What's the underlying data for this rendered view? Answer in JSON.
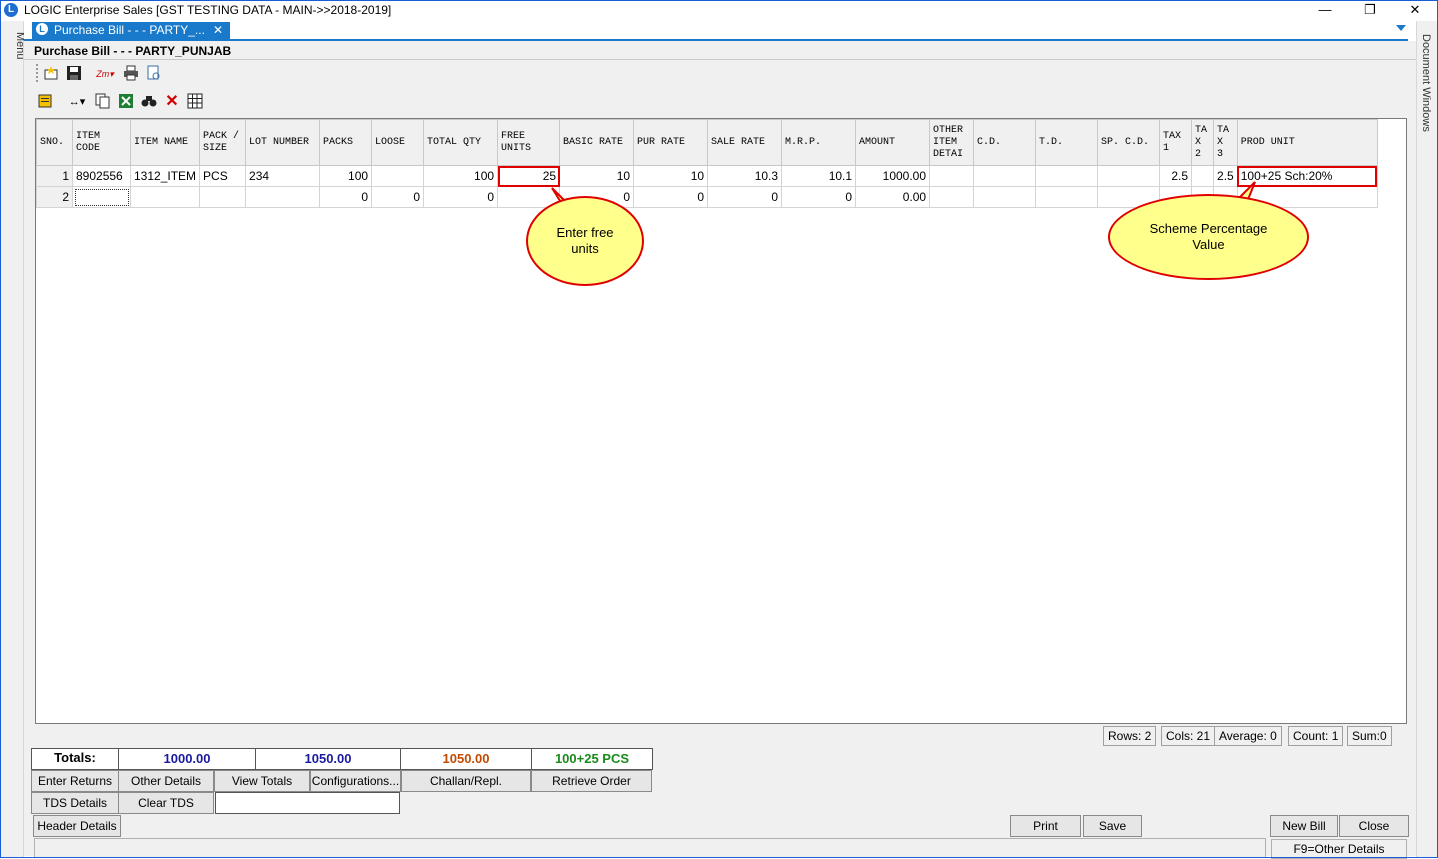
{
  "window": {
    "title": "LOGIC Enterprise Sales  [GST TESTING DATA - MAIN->>2018-2019]",
    "minimize": "—",
    "restore": "❐",
    "close": "✕"
  },
  "side": {
    "left_label": "Menu",
    "right_label": "Document Windows"
  },
  "tab": {
    "label": "Purchase Bill -  -  - PARTY_...",
    "close": "✕"
  },
  "document": {
    "title": "Purchase Bill -  -  - PARTY_PUNJAB"
  },
  "grid": {
    "columns": [
      "SNO.",
      "ITEM CODE",
      "ITEM NAME",
      "PACK / SIZE",
      "LOT NUMBER",
      "PACKS",
      "LOOSE",
      "TOTAL QTY",
      "FREE UNITS",
      "BASIC RATE",
      "PUR RATE",
      "SALE RATE",
      "M.R.P.",
      "AMOUNT",
      "OTHER ITEM DETAI",
      "C.D.",
      "T.D.",
      "SP. C.D.",
      "TAX 1",
      "TA X 2",
      "TA X 3",
      "PROD UNIT"
    ],
    "rows": [
      [
        "1",
        "8902556",
        "1312_ITEM",
        "PCS",
        "234",
        "100",
        "",
        "100",
        "25",
        "10",
        "10",
        "10.3",
        "10.1",
        "1000.00",
        "",
        "",
        "",
        "",
        "2.5",
        "",
        "2.5",
        "100+25 Sch:20%"
      ],
      [
        "2",
        "",
        "",
        "",
        "",
        "0",
        "0",
        "0",
        "",
        "0",
        "0",
        "0",
        "0",
        "0.00",
        "",
        "",
        "",
        "",
        "",
        "",
        "",
        ""
      ]
    ]
  },
  "callouts": {
    "free_units": "Enter free units",
    "scheme": "Scheme Percentage Value"
  },
  "status": {
    "rows": "Rows: 2",
    "cols": "Cols: 21",
    "average": "Average: 0",
    "count": "Count: 1",
    "sum": "Sum:0"
  },
  "totals": {
    "label": "Totals:",
    "amount": "1000.00",
    "amount2": "1050.00",
    "amount3": "1050.00",
    "units": "100+25 PCS",
    "colors": {
      "amount": "#1a1aa0",
      "amount2": "#1a1aa0",
      "amount3": "#c24a00",
      "units": "#1a8a1a"
    }
  },
  "buttons": {
    "enter_returns": "Enter Returns",
    "other_details": "Other Details",
    "view_totals": "View Totals",
    "configurations": "Configurations...",
    "challan": "Challan/Repl.",
    "retrieve_order": "Retrieve Order",
    "tds_details": "TDS Details",
    "clear_tds": "Clear TDS",
    "header_details": "Header Details",
    "print": "Print",
    "save": "Save",
    "new_bill": "New Bill",
    "close": "Close",
    "f9_other": "F9=Other Details"
  },
  "icons": [
    "new-icon",
    "save-icon",
    "zoom-icon",
    "print-icon",
    "preview-icon",
    "notes-icon",
    "column-width-icon",
    "copy-icon",
    "excel-icon",
    "find-icon",
    "delete-icon",
    "grid-icon"
  ]
}
